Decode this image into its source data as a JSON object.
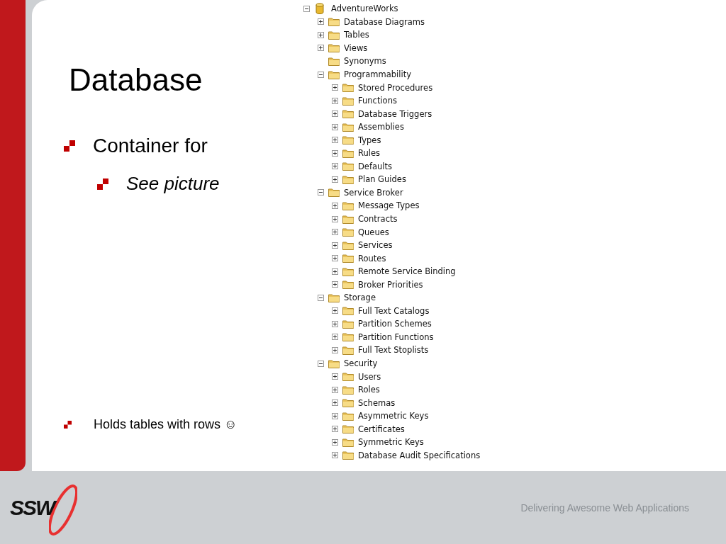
{
  "slide": {
    "title": "Database",
    "bullets": [
      {
        "text": "Container for",
        "children": [
          {
            "text": "See picture"
          }
        ]
      }
    ],
    "bottom_bullet": "Holds tables with rows ☺"
  },
  "tree": [
    {
      "label": "AdventureWorks",
      "kind": "database",
      "expandable": true,
      "expanded": true,
      "children": [
        {
          "label": "Database Diagrams",
          "kind": "folder",
          "expandable": true,
          "expanded": false
        },
        {
          "label": "Tables",
          "kind": "folder",
          "expandable": true,
          "expanded": false
        },
        {
          "label": "Views",
          "kind": "folder",
          "expandable": true,
          "expanded": false
        },
        {
          "label": "Synonyms",
          "kind": "folder",
          "expandable": false
        },
        {
          "label": "Programmability",
          "kind": "folder",
          "expandable": true,
          "expanded": true,
          "children": [
            {
              "label": "Stored Procedures",
              "kind": "folder",
              "expandable": true,
              "expanded": false
            },
            {
              "label": "Functions",
              "kind": "folder",
              "expandable": true,
              "expanded": false
            },
            {
              "label": "Database Triggers",
              "kind": "folder",
              "expandable": true,
              "expanded": false
            },
            {
              "label": "Assemblies",
              "kind": "folder",
              "expandable": true,
              "expanded": false
            },
            {
              "label": "Types",
              "kind": "folder",
              "expandable": true,
              "expanded": false
            },
            {
              "label": "Rules",
              "kind": "folder",
              "expandable": true,
              "expanded": false
            },
            {
              "label": "Defaults",
              "kind": "folder",
              "expandable": true,
              "expanded": false
            },
            {
              "label": "Plan Guides",
              "kind": "folder",
              "expandable": true,
              "expanded": false
            }
          ]
        },
        {
          "label": "Service Broker",
          "kind": "folder",
          "expandable": true,
          "expanded": true,
          "children": [
            {
              "label": "Message Types",
              "kind": "folder",
              "expandable": true,
              "expanded": false
            },
            {
              "label": "Contracts",
              "kind": "folder",
              "expandable": true,
              "expanded": false
            },
            {
              "label": "Queues",
              "kind": "folder",
              "expandable": true,
              "expanded": false
            },
            {
              "label": "Services",
              "kind": "folder",
              "expandable": true,
              "expanded": false
            },
            {
              "label": "Routes",
              "kind": "folder",
              "expandable": true,
              "expanded": false
            },
            {
              "label": "Remote Service Binding",
              "kind": "folder",
              "expandable": true,
              "expanded": false
            },
            {
              "label": "Broker Priorities",
              "kind": "folder",
              "expandable": true,
              "expanded": false
            }
          ]
        },
        {
          "label": "Storage",
          "kind": "folder",
          "expandable": true,
          "expanded": true,
          "children": [
            {
              "label": "Full Text Catalogs",
              "kind": "folder",
              "expandable": true,
              "expanded": false
            },
            {
              "label": "Partition Schemes",
              "kind": "folder",
              "expandable": true,
              "expanded": false
            },
            {
              "label": "Partition Functions",
              "kind": "folder",
              "expandable": true,
              "expanded": false
            },
            {
              "label": "Full Text Stoplists",
              "kind": "folder",
              "expandable": true,
              "expanded": false
            }
          ]
        },
        {
          "label": "Security",
          "kind": "folder",
          "expandable": true,
          "expanded": true,
          "children": [
            {
              "label": "Users",
              "kind": "folder",
              "expandable": true,
              "expanded": false
            },
            {
              "label": "Roles",
              "kind": "folder",
              "expandable": true,
              "expanded": false
            },
            {
              "label": "Schemas",
              "kind": "folder",
              "expandable": true,
              "expanded": false
            },
            {
              "label": "Asymmetric Keys",
              "kind": "folder",
              "expandable": true,
              "expanded": false
            },
            {
              "label": "Certificates",
              "kind": "folder",
              "expandable": true,
              "expanded": false
            },
            {
              "label": "Symmetric Keys",
              "kind": "folder",
              "expandable": true,
              "expanded": false
            },
            {
              "label": "Database Audit Specifications",
              "kind": "folder",
              "expandable": true,
              "expanded": false
            }
          ]
        }
      ]
    }
  ],
  "footer": {
    "logo": "SSW",
    "tagline": "Delivering Awesome Web Applications"
  }
}
